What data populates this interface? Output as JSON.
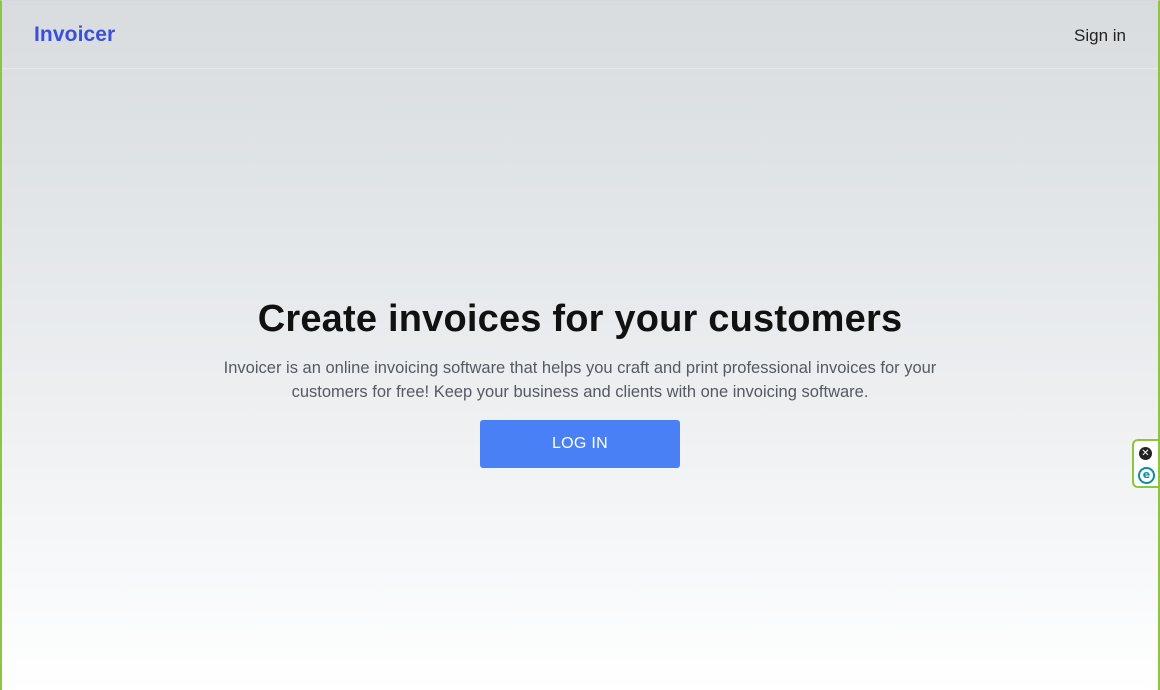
{
  "navbar": {
    "brand": "Invoicer",
    "signin_label": "Sign in"
  },
  "hero": {
    "title": "Create invoices for your customers",
    "description": "Invoicer is an online invoicing software that helps you craft and print professional invoices for your customers for free! Keep your business and clients with one invoicing software.",
    "login_label": "LOG IN"
  },
  "extension_widget": {
    "close_icon": "close-icon",
    "logo_icon": "e-logo-icon",
    "close_glyph": "✕",
    "logo_glyph": "e"
  },
  "colors": {
    "brand": "#3b4fd8",
    "button": "#4a80f5",
    "frame_border": "#8cc63f"
  }
}
